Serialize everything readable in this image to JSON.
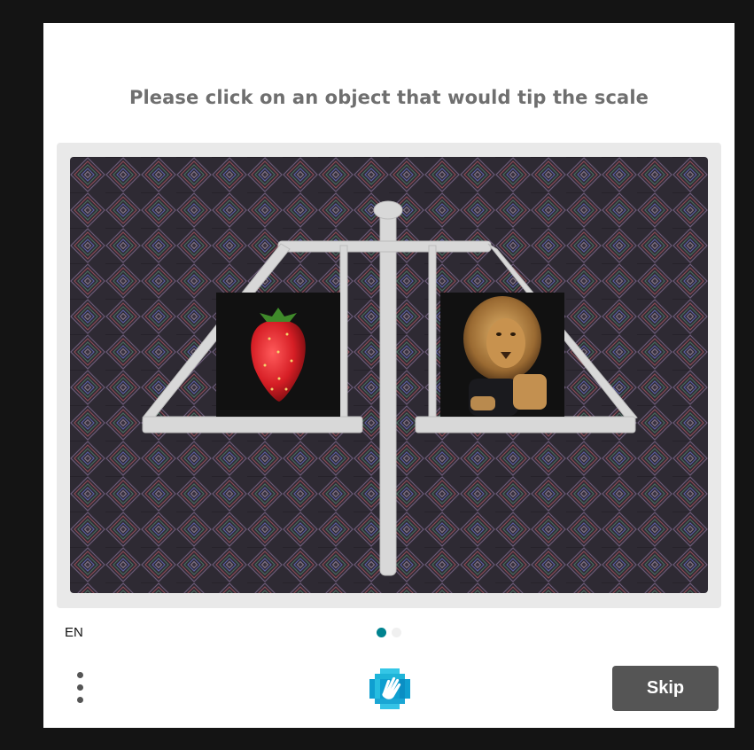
{
  "prompt": "Please click on an object that would tip the scale",
  "task": {
    "left_object": "strawberry",
    "right_object": "lion",
    "background_color": "#3a3340",
    "scale_color": "#d8d8d8"
  },
  "language": "EN",
  "pager": {
    "total": 2,
    "active": 1,
    "active_color": "#00838f"
  },
  "skip_label": "Skip",
  "colors": {
    "page_bg": "#141414",
    "dialog_bg": "#ffffff",
    "frame_bg": "#e9e9e9",
    "button_bg": "#555555",
    "prompt_text": "#6f6f6f"
  },
  "icons": {
    "menu": "vertical-dots-icon",
    "logo": "hcaptcha-hand-icon"
  }
}
